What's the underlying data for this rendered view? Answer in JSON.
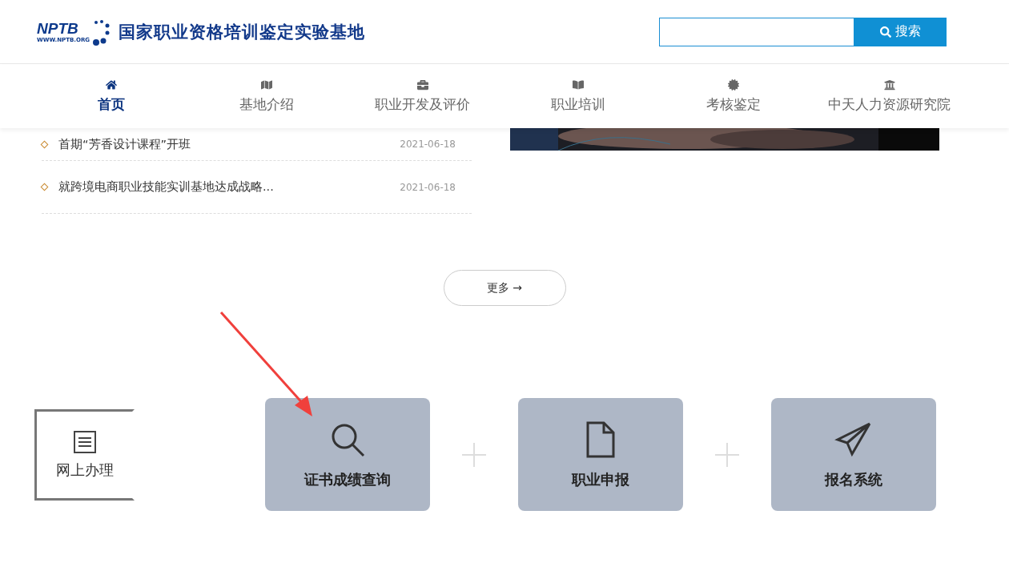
{
  "header": {
    "logo_text": "NPTB",
    "logo_url": "WWW.NPTB.ORG",
    "site_title": "国家职业资格培训鉴定实验基地",
    "search": {
      "button": "搜索"
    }
  },
  "nav": [
    {
      "label": "首页",
      "selected": true
    },
    {
      "label": "基地介绍",
      "selected": false
    },
    {
      "label": "职业开发及评价",
      "selected": false
    },
    {
      "label": "职业培训",
      "selected": false
    },
    {
      "label": "考核鉴定",
      "selected": false
    },
    {
      "label": "中天人力资源研究院",
      "selected": false
    }
  ],
  "news": [
    {
      "title": "首期“芳香设计课程”开班",
      "date": "2021-06-18"
    },
    {
      "title": "就跨境电商职业技能实训基地达成战略...",
      "date": "2021-06-18"
    }
  ],
  "more_button": "更多 →",
  "services": {
    "title": "网上办理",
    "tiles": [
      {
        "label": "证书成绩查询"
      },
      {
        "label": "职业申报"
      },
      {
        "label": "报名系统"
      }
    ]
  }
}
